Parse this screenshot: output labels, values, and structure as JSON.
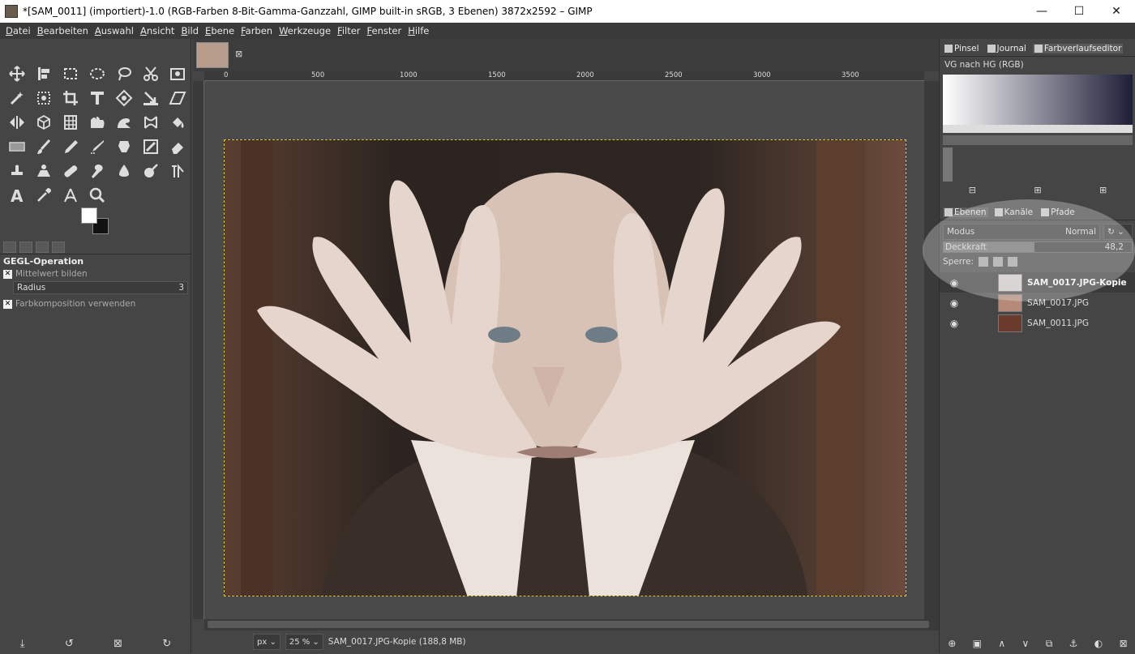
{
  "window": {
    "title": "*[SAM_0011] (importiert)-1.0 (RGB-Farben 8-Bit-Gamma-Ganzzahl, GIMP built-in sRGB, 3 Ebenen) 3872x2592 – GIMP",
    "minimize": "—",
    "maximize": "☐",
    "close": "✕"
  },
  "menu": [
    "Datei",
    "Bearbeiten",
    "Auswahl",
    "Ansicht",
    "Bild",
    "Ebene",
    "Farben",
    "Werkzeuge",
    "Filter",
    "Fenster",
    "Hilfe"
  ],
  "tool_options": {
    "title": "GEGL-Operation",
    "mittelwert_label": "Mittelwert bilden",
    "radius_label": "Radius",
    "radius_value": "3",
    "farbkomposition_label": "Farbkomposition verwenden"
  },
  "image_tab": {
    "close": "⊠"
  },
  "ruler": {
    "h": [
      "0",
      "500",
      "1000",
      "1500",
      "2000",
      "2500",
      "3000",
      "3500"
    ],
    "v": [
      "0",
      "5\n0\n0",
      "1\n0\n0\n0",
      "1\n5\n0\n0",
      "2\n0\n0\n0",
      "2\n5\n0\n0"
    ]
  },
  "statusbar": {
    "unit": "px",
    "zoom": "25 %",
    "info": "SAM_0017.JPG-Kopie (188,8 MB)"
  },
  "dock_top": {
    "tabs": [
      "Pinsel",
      "Journal",
      "Farbverlaufseditor"
    ],
    "gradient_name": "VG nach HG (RGB)"
  },
  "layers_panel": {
    "tabs": [
      "Ebenen",
      "Kanäle",
      "Pfade"
    ],
    "modus_label": "Modus",
    "modus_value": "Normal",
    "opacity_label": "Deckkraft",
    "opacity_value": "48,2",
    "opacity_fraction": 0.482,
    "lock_label": "Sperre:",
    "layers": [
      {
        "name": "SAM_0017.JPG-Kopie",
        "active": true
      },
      {
        "name": "SAM_0017.JPG",
        "active": false
      },
      {
        "name": "SAM_0011.JPG",
        "active": false
      }
    ]
  }
}
